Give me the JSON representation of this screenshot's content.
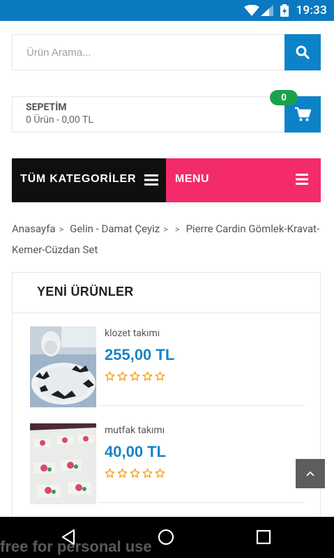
{
  "status_bar": {
    "time": "19:33",
    "icons": [
      "wifi-icon",
      "signal-icon",
      "battery-charging-icon"
    ],
    "color": "#0a79c0"
  },
  "search": {
    "placeholder": "Ürün Arama...",
    "value": "",
    "button_icon": "search-icon",
    "accent": "#0c83c9"
  },
  "cart": {
    "title": "SEPETİM",
    "summary": "0 Ürün - 0,00 TL",
    "badge": "0",
    "icon": "cart-icon",
    "badge_color": "#1aa14a"
  },
  "category_bar": {
    "all_categories_label": "TÜM KATEGORİLER",
    "menu_label": "MENU",
    "all_color": "#0f0f0f",
    "menu_color": "#f32b6b"
  },
  "breadcrumb": {
    "items": [
      "Anasayfa",
      "Gelin - Damat Çeyiz",
      "",
      "Pierre Cardin Gömlek-Kravat-Kemer-Cüzdan Set"
    ]
  },
  "new_products": {
    "title": "YENİ ÜRÜNLER",
    "items": [
      {
        "name": "klozet takımı",
        "price": "255,00 TL",
        "rating": 0,
        "max_rating": 5
      },
      {
        "name": "mutfak takımı",
        "price": "40,00 TL",
        "rating": 0,
        "max_rating": 5
      }
    ],
    "price_color": "#1a82c4",
    "star_color": "#f0a21b"
  },
  "scroll_top": {
    "icon": "chevron-up-icon"
  },
  "nav_bar": {
    "buttons": [
      "back-icon",
      "home-icon",
      "recents-icon"
    ]
  },
  "watermark": "free for personal use"
}
